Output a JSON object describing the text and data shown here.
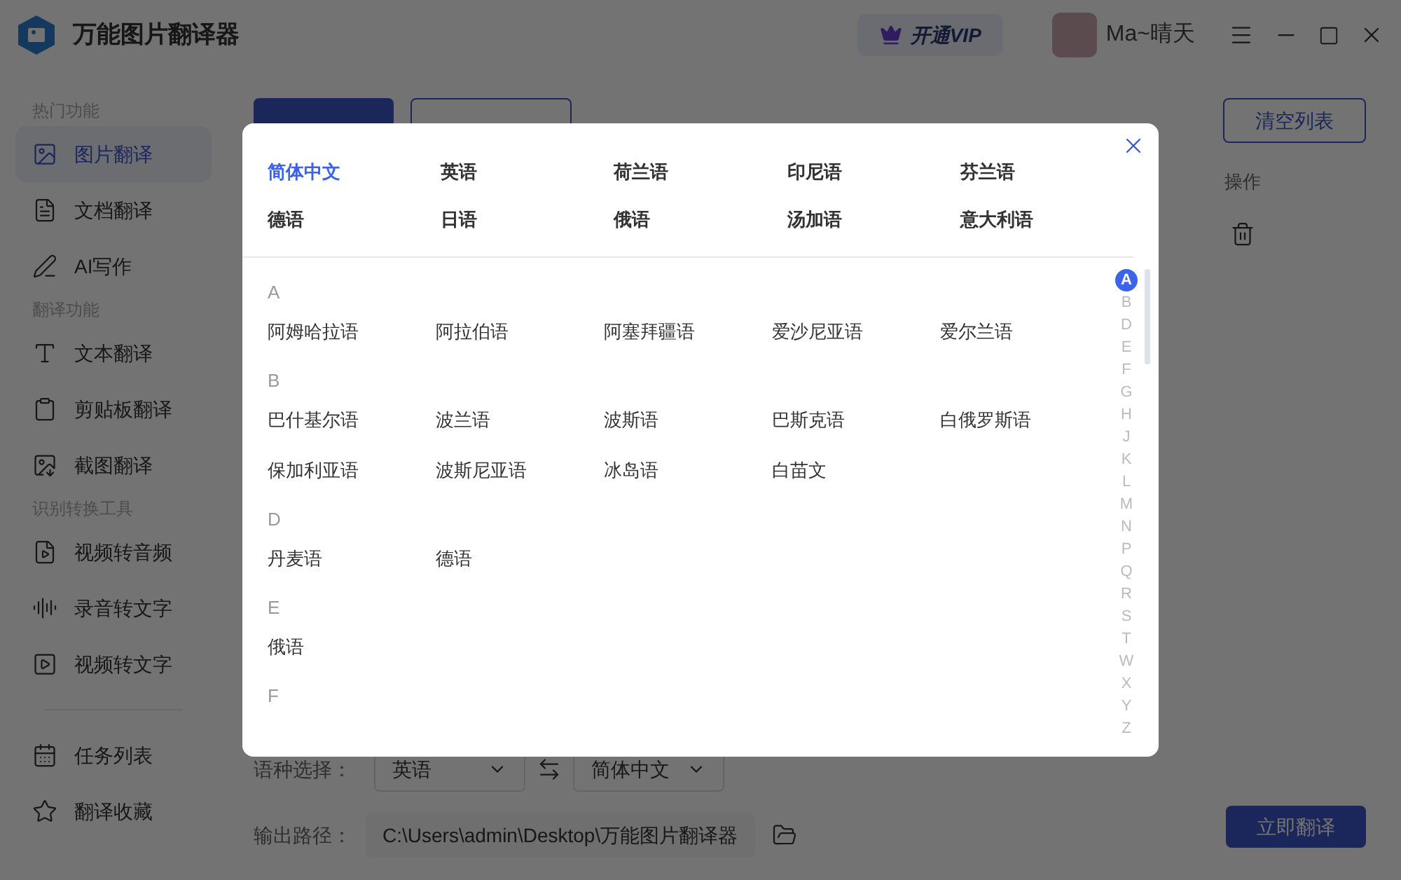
{
  "app": {
    "title": "万能图片翻译器",
    "vip": "开通VIP",
    "user": "Ma~晴天"
  },
  "sidebar": {
    "groups": [
      {
        "heading": "热门功能",
        "items": [
          {
            "label": "图片翻译",
            "selected": true
          },
          {
            "label": "文档翻译",
            "selected": false
          },
          {
            "label": "AI写作",
            "selected": false
          }
        ]
      },
      {
        "heading": "翻译功能",
        "items": [
          {
            "label": "文本翻译",
            "selected": false
          },
          {
            "label": "剪贴板翻译",
            "selected": false
          },
          {
            "label": "截图翻译",
            "selected": false
          }
        ]
      },
      {
        "heading": "识别转换工具",
        "items": [
          {
            "label": "视频转音频",
            "selected": false
          },
          {
            "label": "录音转文字",
            "selected": false
          },
          {
            "label": "视频转文字",
            "selected": false
          }
        ]
      }
    ],
    "bottom": [
      {
        "label": "任务列表",
        "selected": false
      },
      {
        "label": "翻译收藏",
        "selected": false
      }
    ]
  },
  "toolbar": {
    "clear": "清空列表"
  },
  "table": {
    "column_action": "操作"
  },
  "language": {
    "label": "语种选择：",
    "source": "英语",
    "target": "简体中文"
  },
  "output": {
    "label": "输出路径：",
    "path": "C:\\Users\\admin\\Desktop\\万能图片翻译器"
  },
  "translate_button": "立即翻译",
  "dialog": {
    "common": [
      {
        "label": "简体中文",
        "selected": true
      },
      {
        "label": "英语",
        "selected": false
      },
      {
        "label": "荷兰语",
        "selected": false
      },
      {
        "label": "印尼语",
        "selected": false
      },
      {
        "label": "芬兰语",
        "selected": false
      },
      {
        "label": "德语",
        "selected": false
      },
      {
        "label": "日语",
        "selected": false
      },
      {
        "label": "俄语",
        "selected": false
      },
      {
        "label": "汤加语",
        "selected": false
      },
      {
        "label": "意大利语",
        "selected": false
      }
    ],
    "sections": [
      {
        "letter": "A",
        "languages": [
          "阿姆哈拉语",
          "阿拉伯语",
          "阿塞拜疆语",
          "爱沙尼亚语",
          "爱尔兰语"
        ]
      },
      {
        "letter": "B",
        "languages": [
          "巴什基尔语",
          "波兰语",
          "波斯语",
          "巴斯克语",
          "白俄罗斯语",
          "保加利亚语",
          "波斯尼亚语",
          "冰岛语",
          "白苗文"
        ]
      },
      {
        "letter": "D",
        "languages": [
          "丹麦语",
          "德语"
        ]
      },
      {
        "letter": "E",
        "languages": [
          "俄语"
        ]
      },
      {
        "letter": "F"
      }
    ],
    "index": [
      {
        "letter": "A",
        "selected": true
      },
      {
        "letter": "B",
        "selected": false
      },
      {
        "letter": "D",
        "selected": false
      },
      {
        "letter": "E",
        "selected": false
      },
      {
        "letter": "F",
        "selected": false
      },
      {
        "letter": "G",
        "selected": false
      },
      {
        "letter": "H",
        "selected": false
      },
      {
        "letter": "J",
        "selected": false
      },
      {
        "letter": "K",
        "selected": false
      },
      {
        "letter": "L",
        "selected": false
      },
      {
        "letter": "M",
        "selected": false
      },
      {
        "letter": "N",
        "selected": false
      },
      {
        "letter": "P",
        "selected": false
      },
      {
        "letter": "Q",
        "selected": false
      },
      {
        "letter": "R",
        "selected": false
      },
      {
        "letter": "S",
        "selected": false
      },
      {
        "letter": "T",
        "selected": false
      },
      {
        "letter": "W",
        "selected": false
      },
      {
        "letter": "X",
        "selected": false
      },
      {
        "letter": "Y",
        "selected": false
      },
      {
        "letter": "Z",
        "selected": false
      }
    ]
  }
}
